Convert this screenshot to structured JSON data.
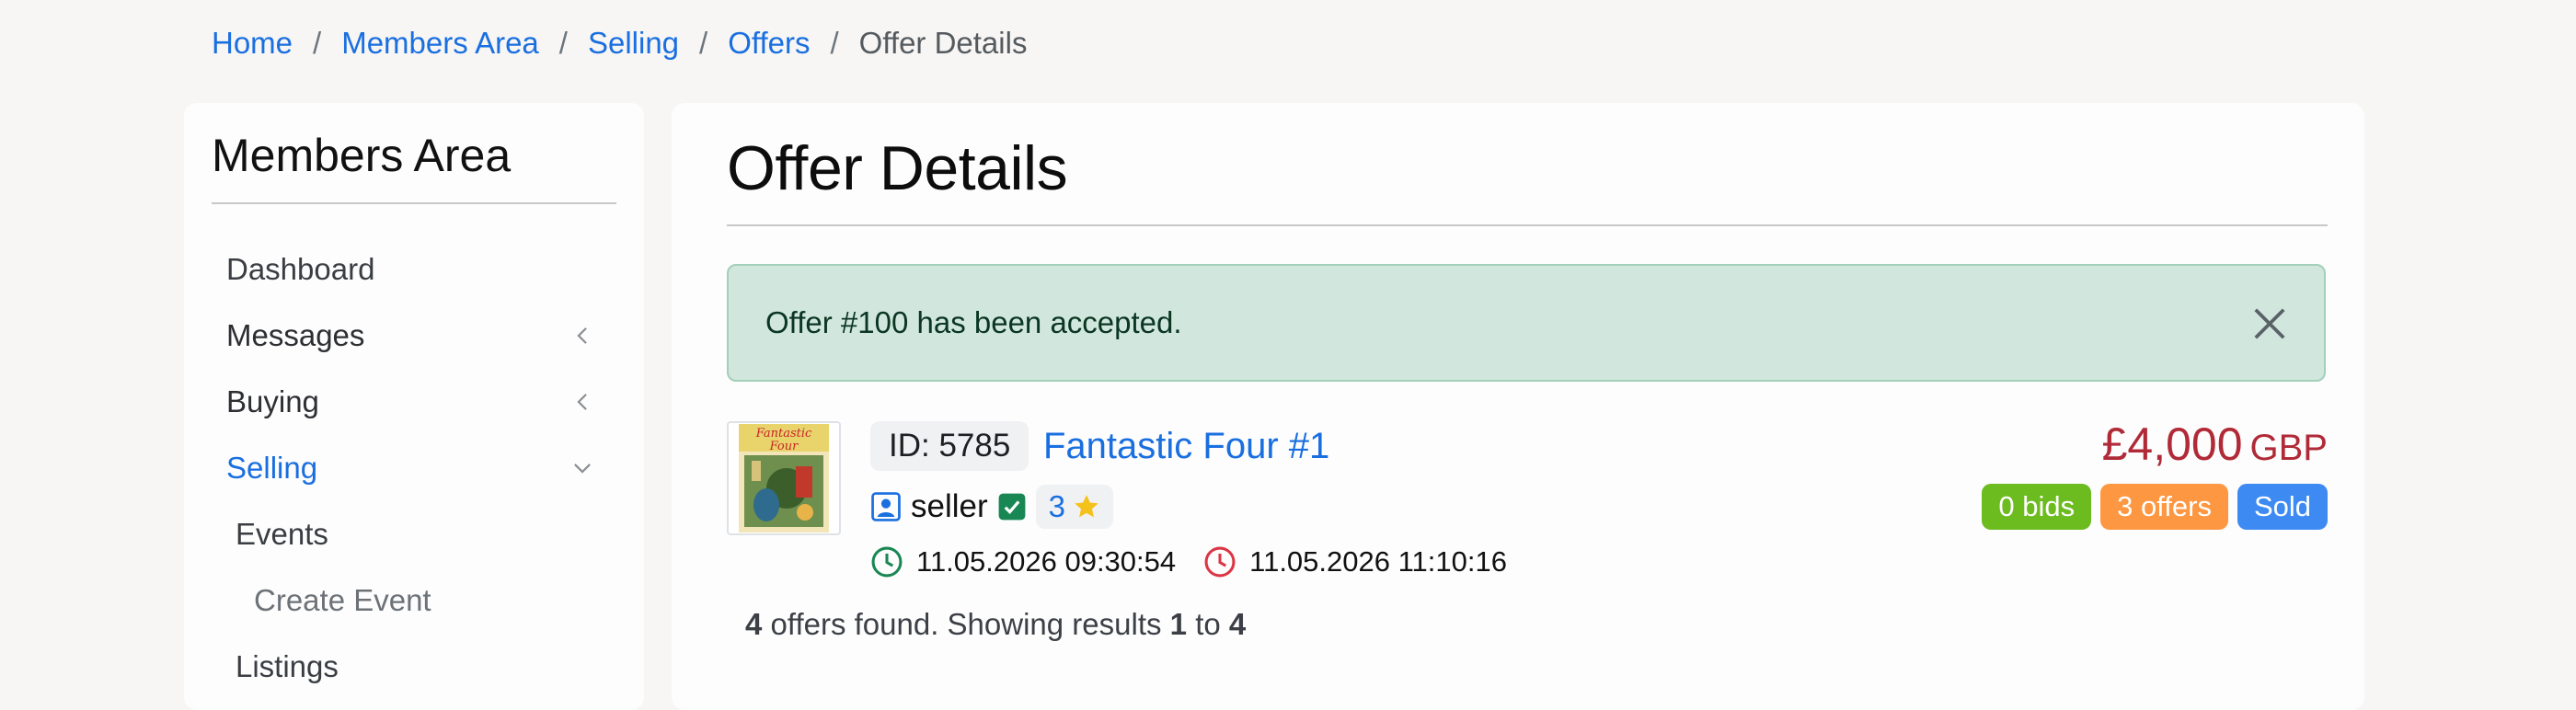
{
  "breadcrumb": {
    "items": [
      "Home",
      "Members Area",
      "Selling",
      "Offers"
    ],
    "current": "Offer Details",
    "separator": "/"
  },
  "sidebar": {
    "title": "Members Area",
    "items": [
      {
        "label": "Dashboard",
        "chevron": null
      },
      {
        "label": "Messages",
        "chevron": "chevron-left-icon"
      },
      {
        "label": "Buying",
        "chevron": "chevron-left-icon"
      },
      {
        "label": "Selling",
        "chevron": "chevron-down-icon"
      }
    ],
    "sub_items": [
      "Events"
    ],
    "sub_sub_items": [
      "Create Event"
    ],
    "next_item": "Listings"
  },
  "main": {
    "title": "Offer Details",
    "alert": {
      "message": "Offer #100 has been accepted."
    },
    "listing": {
      "id_label": "ID: 5785",
      "title": "Fantastic Four #1",
      "thumbnail_text": "Fantastic Four",
      "seller": "seller",
      "rating": "3",
      "start_date": "11.05.2026 09:30:54",
      "end_date": "11.05.2026 11:10:16",
      "price": "£4,000",
      "currency": "GBP",
      "badges": {
        "bids": "0 bids",
        "offers": "3 offers",
        "status": "Sold"
      }
    },
    "results": {
      "count": "4",
      "text1": " offers found. Showing results ",
      "from": "1",
      "text2": " to ",
      "to": "4"
    }
  },
  "colors": {
    "link": "#1a6fe0",
    "alert_bg": "#d1e7dd",
    "price": "#b02a37",
    "badge_bids": "#6cbb1f",
    "badge_offers": "#fd9742",
    "badge_sold": "#3d8bf2",
    "start_clock": "#198754",
    "end_clock": "#dc3545"
  }
}
